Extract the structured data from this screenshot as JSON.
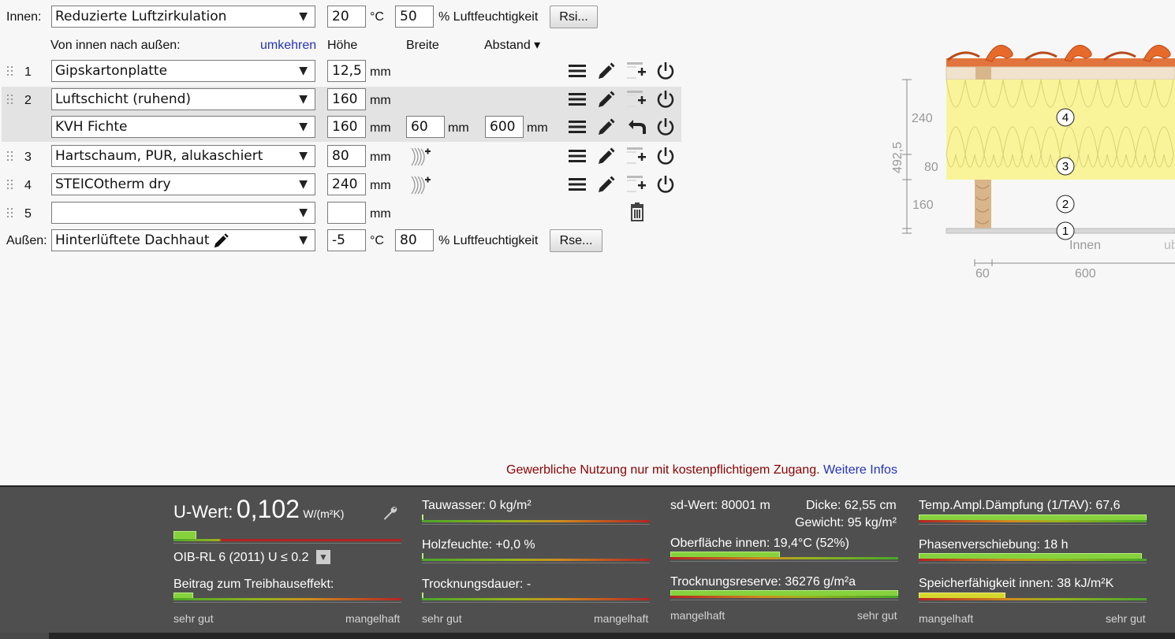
{
  "inside": {
    "label": "Innen:",
    "climate": "Reduzierte Luftzirkulation",
    "temp": "20",
    "temp_unit": "°C",
    "humidity": "50",
    "humidity_unit": "% Luftfeuchtigkeit",
    "rsi_button": "Rsi..."
  },
  "header": {
    "direction": "Von innen nach außen:",
    "reverse_link": "umkehren",
    "col_height": "Höhe",
    "col_width": "Breite",
    "col_spacing": "Abstand ▾"
  },
  "layers": [
    {
      "num": "1",
      "material": "Gipskartonplatte",
      "height": "12,5",
      "unit": "mm"
    },
    {
      "num": "2",
      "material": "Luftschicht (ruhend)",
      "height": "160",
      "unit": "mm"
    },
    {
      "num": "",
      "material": "KVH Fichte",
      "height": "160",
      "unit": "mm",
      "width": "60",
      "width_unit": "mm",
      "spacing": "600",
      "spacing_unit": "mm"
    },
    {
      "num": "3",
      "material": "Hartschaum, PUR, alukaschiert",
      "height": "80",
      "unit": "mm"
    },
    {
      "num": "4",
      "material": "STEICOtherm dry",
      "height": "240",
      "unit": "mm"
    },
    {
      "num": "5",
      "material": "",
      "height": "",
      "unit": "mm"
    }
  ],
  "outside": {
    "label": "Außen:",
    "climate": "Hinterlüftete Dachhaut",
    "temp": "-5",
    "temp_unit": "°C",
    "humidity": "80",
    "humidity_unit": "% Luftfeuchtigkeit",
    "rse_button": "Rse..."
  },
  "diagram": {
    "total": "492,5",
    "dims": [
      "240",
      "80",
      "160"
    ],
    "markers": [
      "4",
      "3",
      "2",
      "1"
    ],
    "inside_label": "Innen",
    "outside_label": "ub",
    "bottom_dims": [
      "60",
      "600"
    ]
  },
  "notice": {
    "text": "Gewerbliche Nutzung nur mit kostenpflichtigem Zugang.",
    "link": "Weitere Infos"
  },
  "results": {
    "uwert_label": "U-Wert:",
    "uwert_value": "0,102",
    "uwert_unit": "W/(m²K)",
    "uwert_fill": 0.1,
    "norm": "OIB-RL 6 (2011) U ≤ 0.2",
    "treibhaus": "Beitrag zum Treibhauseffekt:",
    "treibhaus_fill": 0.085,
    "scale_good": "sehr gut",
    "scale_bad": "mangelhaft",
    "tauwasser": "Tauwasser: 0 kg/m²",
    "holzfeuchte": "Holzfeuchte: +0,0 %",
    "trocknungsdauer": "Trocknungsdauer: -",
    "sd_wert": "sd-Wert: 80001 m",
    "dicke": "Dicke: 62,55 cm",
    "gewicht": "Gewicht: 95 kg/m²",
    "oberflaeche": "Oberfläche innen: 19,4°C (52%)",
    "oberflaeche_fill": 0.48,
    "trocknungsreserve": "Trocknungsreserve: 36276 g/m²a",
    "trocknungsreserve_fill": 1.0,
    "tav": "Temp.Ampl.Dämpfung (1/TAV): 67,6",
    "tav_fill": 1.0,
    "phase": "Phasenverschiebung: 18 h",
    "phase_fill": 0.98,
    "speicher": "Speicherfähigkeit innen: 38 kJ/m²K",
    "speicher_fill": 0.38
  },
  "colors": {
    "link": "#2233bb",
    "notice": "#8b0000",
    "bar_fill": "#86d23d",
    "panel_bg": "#4f4f4f",
    "insulation": "#f9f49a",
    "roof_tile": "#e86a2a"
  }
}
